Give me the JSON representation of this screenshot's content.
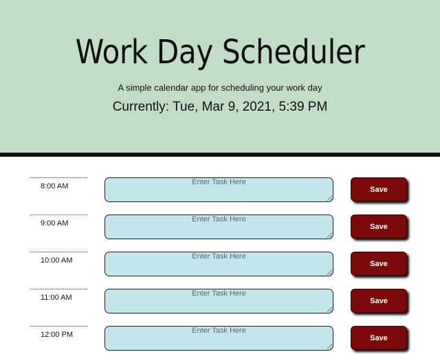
{
  "header": {
    "title": "Work Day Scheduler",
    "lead": "A simple calendar app for scheduling your work day",
    "current_day": "Currently: Tue, Mar 9, 2021, 5:39 PM"
  },
  "colors": {
    "header_bg": "#c1ddc6",
    "task_bg": "#c3e6ec",
    "save_bg": "#7d0a0a"
  },
  "timeblocks": [
    {
      "hour": "8:00 AM",
      "placeholder": "Enter Task Here",
      "value": "",
      "save_label": "Save"
    },
    {
      "hour": "9:00 AM",
      "placeholder": "Enter Task Here",
      "value": "",
      "save_label": "Save"
    },
    {
      "hour": "10:00 AM",
      "placeholder": "Enter Task Here",
      "value": "",
      "save_label": "Save"
    },
    {
      "hour": "11:00 AM",
      "placeholder": "Enter Task Here",
      "value": "",
      "save_label": "Save"
    },
    {
      "hour": "12:00 PM",
      "placeholder": "Enter Task Here",
      "value": "",
      "save_label": "Save"
    }
  ]
}
